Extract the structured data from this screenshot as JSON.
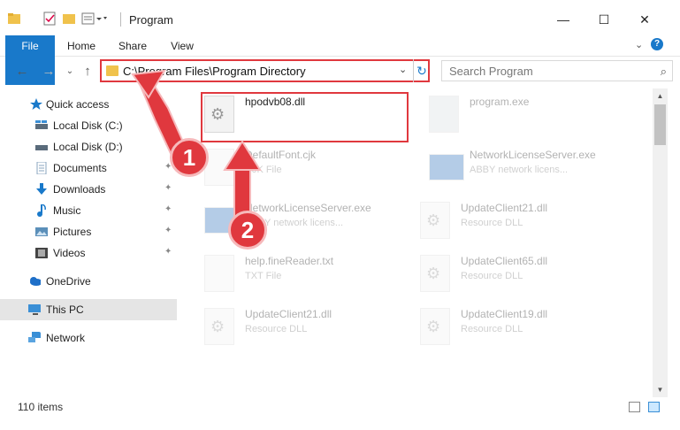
{
  "window": {
    "title": "Program",
    "minimize": "—",
    "maximize": "☐",
    "close": "✕"
  },
  "ribbon": {
    "tabs": [
      "File",
      "Home",
      "Share",
      "View"
    ],
    "expand": "⌄",
    "help": "?"
  },
  "address": {
    "path": "C:\\Program Files\\Program Directory",
    "dropdown": "⌄",
    "refresh": "↻"
  },
  "search": {
    "placeholder": "Search Program",
    "icon": "⌕"
  },
  "nav": {
    "back": "←",
    "forward": "→",
    "recent": "⌄",
    "up": "↑"
  },
  "sidebar": {
    "items": [
      {
        "label": "Quick access",
        "icon": "star-icon",
        "color": "#1979ca"
      },
      {
        "label": "Local Disk (C:)",
        "icon": "drive-icon",
        "color": "#5a6b7b",
        "pinned": true
      },
      {
        "label": "Local Disk (D:)",
        "icon": "drive-icon",
        "color": "#5a6b7b",
        "pinned": true
      },
      {
        "label": "Documents",
        "icon": "documents-icon",
        "color": "#8aa4bf",
        "pinned": true
      },
      {
        "label": "Downloads",
        "icon": "downloads-icon",
        "color": "#1979ca",
        "pinned": true
      },
      {
        "label": "Music",
        "icon": "music-icon",
        "color": "#1979ca",
        "pinned": true
      },
      {
        "label": "Pictures",
        "icon": "pictures-icon",
        "color": "#5b8fb9",
        "pinned": true
      },
      {
        "label": "Videos",
        "icon": "videos-icon",
        "color": "#444",
        "pinned": true
      },
      {
        "label": "OneDrive",
        "icon": "cloud-icon",
        "color": "#1e6fc8"
      },
      {
        "label": "This PC",
        "icon": "computer-icon",
        "color": "#3a8fd6"
      },
      {
        "label": "Network",
        "icon": "network-icon",
        "color": "#3a8fd6"
      }
    ],
    "pin_glyph": "📌"
  },
  "files": [
    {
      "name": "hpodvb08.dll",
      "type": "",
      "highlighted": true
    },
    {
      "name": "program.exe",
      "type": ""
    },
    {
      "name": "DefaultFont.cjk",
      "type": "CJK File"
    },
    {
      "name": "NetworkLicenseServer.exe",
      "type": "ABBY network licens..."
    },
    {
      "name": "NetworkLicenseServer.exe",
      "type": "ABBY network licens..."
    },
    {
      "name": "UpdateClient21.dll",
      "type": "Resource DLL"
    },
    {
      "name": "help.fineReader.txt",
      "type": "TXT File"
    },
    {
      "name": "UpdateClient65.dll",
      "type": "Resource DLL"
    },
    {
      "name": "UpdateClient21.dll",
      "type": "Resource DLL"
    },
    {
      "name": "UpdateClient19.dll",
      "type": "Resource DLL"
    }
  ],
  "status": {
    "item_count": "110 items"
  },
  "annotations": {
    "step1": "1",
    "step2": "2",
    "color": "#e0383e"
  }
}
